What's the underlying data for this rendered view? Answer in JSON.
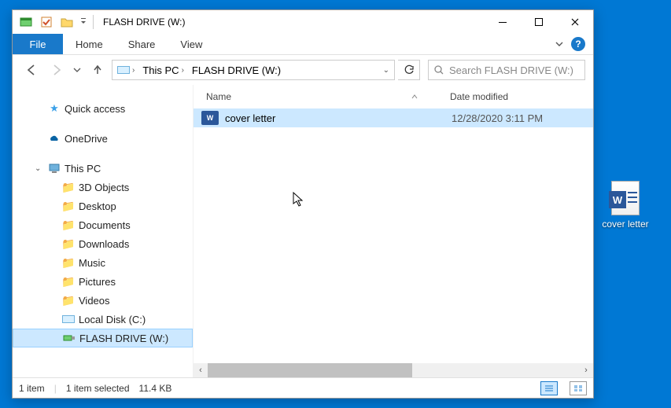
{
  "window": {
    "title": "FLASH DRIVE (W:)"
  },
  "tabs": {
    "file": "File",
    "home": "Home",
    "share": "Share",
    "view": "View"
  },
  "breadcrumbs": {
    "this_pc": "This PC",
    "drive": "FLASH DRIVE (W:)"
  },
  "search": {
    "placeholder": "Search FLASH DRIVE (W:)"
  },
  "sidebar": {
    "quick_access": "Quick access",
    "onedrive": "OneDrive",
    "this_pc": "This PC",
    "children": {
      "objects3d": "3D Objects",
      "desktop": "Desktop",
      "documents": "Documents",
      "downloads": "Downloads",
      "music": "Music",
      "pictures": "Pictures",
      "videos": "Videos",
      "local_disk": "Local Disk (C:)",
      "flash_drive": "FLASH DRIVE (W:)"
    }
  },
  "columns": {
    "name": "Name",
    "date": "Date modified"
  },
  "files": [
    {
      "name": "cover letter",
      "date": "12/28/2020 3:11 PM"
    }
  ],
  "status": {
    "count": "1 item",
    "selected": "1 item selected",
    "size": "11.4 KB"
  },
  "desktop": {
    "file_label": "cover letter"
  }
}
